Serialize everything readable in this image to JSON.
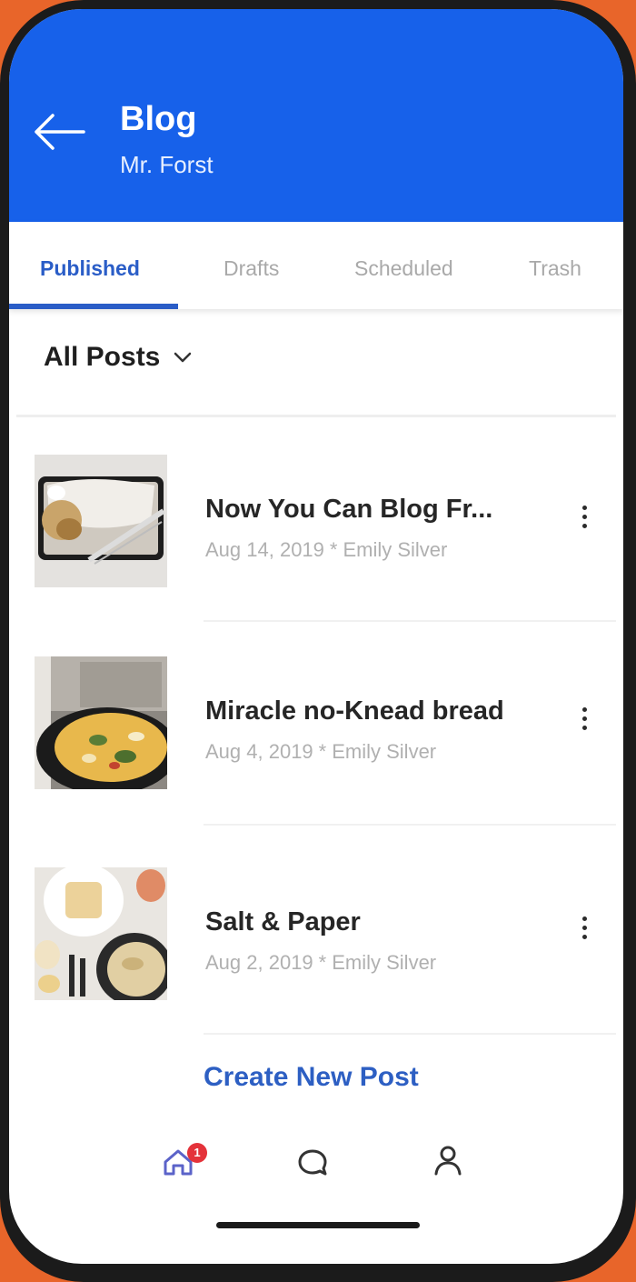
{
  "header": {
    "title": "Blog",
    "subtitle": "Mr. Forst",
    "back_icon": "arrow-left-icon",
    "background_color": "#1761ea"
  },
  "tabs": [
    {
      "label": "Published",
      "active": true
    },
    {
      "label": "Drafts",
      "active": false
    },
    {
      "label": "Scheduled",
      "active": false
    },
    {
      "label": "Trash",
      "active": false
    }
  ],
  "filter": {
    "label": "All Posts",
    "icon": "chevron-down-icon"
  },
  "posts": [
    {
      "title": "Now You Can Blog Fr...",
      "date": "Aug 14, 2019",
      "separator": "*",
      "author": "Emily Silver",
      "thumbnail": "food-photo-baking-tray"
    },
    {
      "title": "Miracle no-Knead bread",
      "date": "Aug 4, 2019",
      "separator": "*",
      "author": "Emily Silver",
      "thumbnail": "food-photo-frittata-pan"
    },
    {
      "title": "Salt & Paper",
      "date": "Aug 2, 2019",
      "separator": "*",
      "author": "Emily Silver",
      "thumbnail": "food-photo-breakfast-table"
    }
  ],
  "create_button": {
    "label": "Create New Post"
  },
  "bottom_nav": {
    "items": [
      {
        "icon": "home-icon",
        "badge": "1"
      },
      {
        "icon": "chat-icon"
      },
      {
        "icon": "profile-icon"
      }
    ]
  },
  "colors": {
    "accent": "#2a5dc7",
    "page_background": "#e8652a",
    "badge": "#e4323a"
  }
}
